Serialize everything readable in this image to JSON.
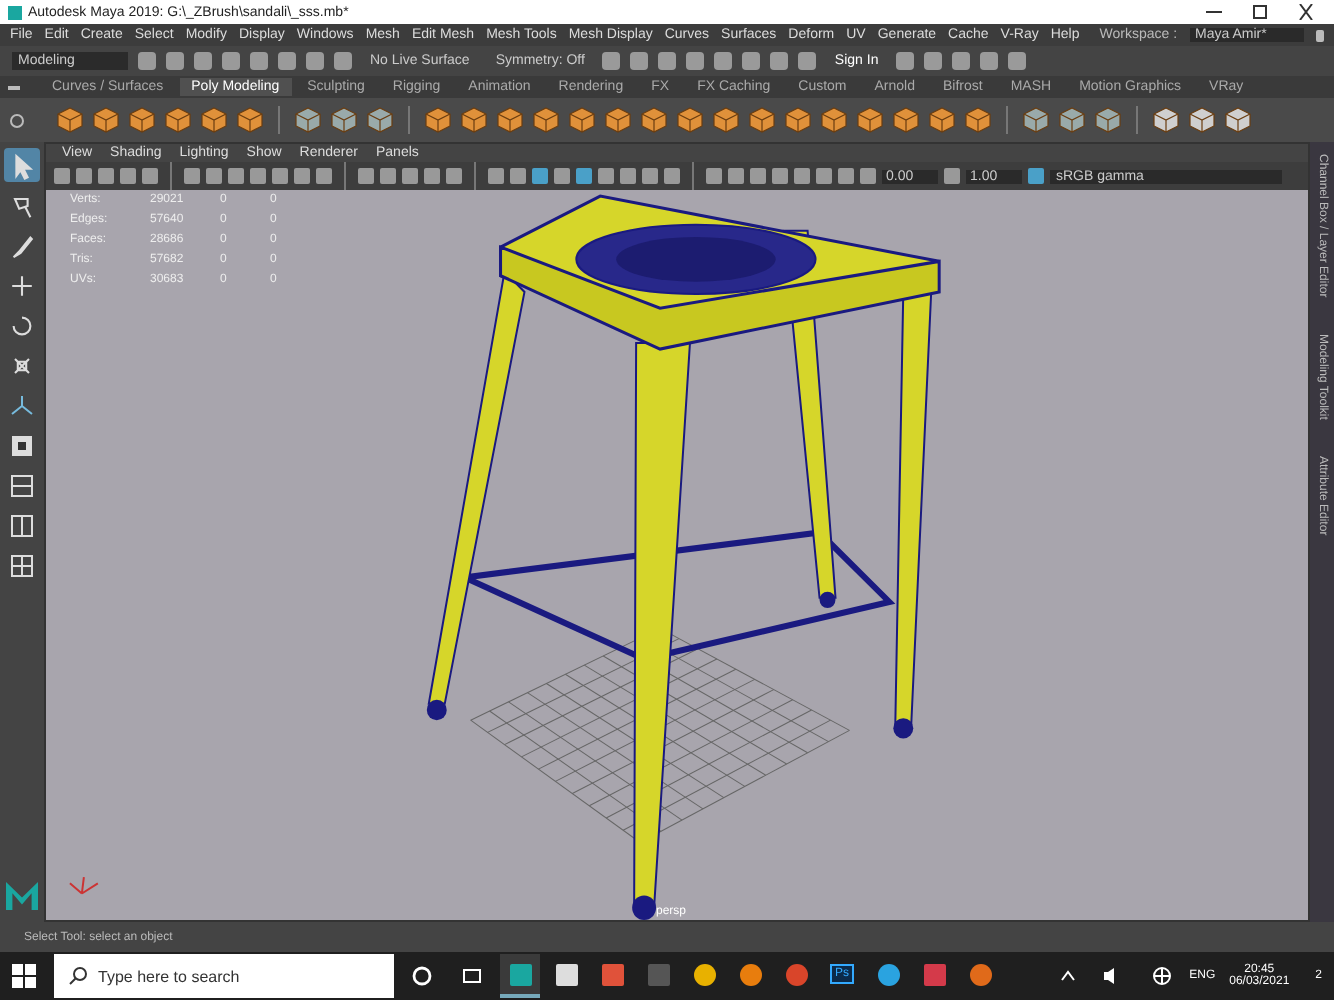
{
  "window": {
    "title": "Autodesk Maya 2019: G:\\_ZBrush\\sandali\\_sss.mb*"
  },
  "menu_bar": [
    "File",
    "Edit",
    "Create",
    "Select",
    "Modify",
    "Display",
    "Windows",
    "Mesh",
    "Edit Mesh",
    "Mesh Tools",
    "Mesh Display",
    "Curves",
    "Surfaces",
    "Deform",
    "UV",
    "Generate",
    "Cache",
    "V-Ray",
    "Help"
  ],
  "workspace": {
    "label": "Workspace :",
    "value": "Maya Amir*"
  },
  "status_line": {
    "mode": "Modeling",
    "live_surface": "No Live Surface",
    "symmetry": "Symmetry: Off",
    "sign_in": "Sign In"
  },
  "shelf_tabs": [
    {
      "label": "Curves / Surfaces",
      "selected": false
    },
    {
      "label": "Poly Modeling",
      "selected": true
    },
    {
      "label": "Sculpting",
      "selected": false
    },
    {
      "label": "Rigging",
      "selected": false
    },
    {
      "label": "Animation",
      "selected": false
    },
    {
      "label": "Rendering",
      "selected": false
    },
    {
      "label": "FX",
      "selected": false
    },
    {
      "label": "FX Caching",
      "selected": false
    },
    {
      "label": "Custom",
      "selected": false
    },
    {
      "label": "Arnold",
      "selected": false
    },
    {
      "label": "Bifrost",
      "selected": false
    },
    {
      "label": "MASH",
      "selected": false
    },
    {
      "label": "Motion Graphics",
      "selected": false
    },
    {
      "label": "VRay",
      "selected": false
    }
  ],
  "tools": [
    {
      "kind": "select",
      "selected": true
    },
    {
      "kind": "lasso",
      "selected": false
    },
    {
      "kind": "paint",
      "selected": false
    },
    {
      "kind": "move",
      "selected": false
    },
    {
      "kind": "rotate",
      "selected": false
    },
    {
      "kind": "scale",
      "selected": false
    }
  ],
  "panel_menu": [
    "View",
    "Shading",
    "Lighting",
    "Show",
    "Renderer",
    "Panels"
  ],
  "panel_toolbar": {
    "exposure": "0.00",
    "gamma": "1.00",
    "color_space": "sRGB gamma"
  },
  "hud": [
    {
      "label": "Verts:",
      "values": [
        "29021",
        "0",
        "0"
      ]
    },
    {
      "label": "Edges:",
      "values": [
        "57640",
        "0",
        "0"
      ]
    },
    {
      "label": "Faces:",
      "values": [
        "28686",
        "0",
        "0"
      ]
    },
    {
      "label": "Tris:",
      "values": [
        "57682",
        "0",
        "0"
      ]
    },
    {
      "label": "UVs:",
      "values": [
        "30683",
        "0",
        "0"
      ]
    }
  ],
  "camera_label": "persp",
  "side_tabs": [
    "Channel Box / Layer Editor",
    "Modeling Toolkit",
    "Attribute Editor"
  ],
  "help_line": "Select Tool: select an object",
  "taskbar": {
    "search_placeholder": "Type here to search",
    "apps": [
      {
        "kind": "maya",
        "selected": true
      },
      {
        "kind": "figure",
        "selected": false
      },
      {
        "kind": "red",
        "selected": false
      },
      {
        "kind": "record",
        "selected": false
      },
      {
        "kind": "browser",
        "selected": false
      },
      {
        "kind": "blender",
        "selected": false
      },
      {
        "kind": "letter",
        "selected": false
      },
      {
        "kind": "ps",
        "label": "Ps",
        "selected": false
      },
      {
        "kind": "plane",
        "selected": false
      },
      {
        "kind": "shield",
        "selected": false
      },
      {
        "kind": "ring",
        "selected": false
      }
    ],
    "language": "ENG",
    "time": "20:45",
    "date": "06/03/2021",
    "notifications": "2"
  }
}
